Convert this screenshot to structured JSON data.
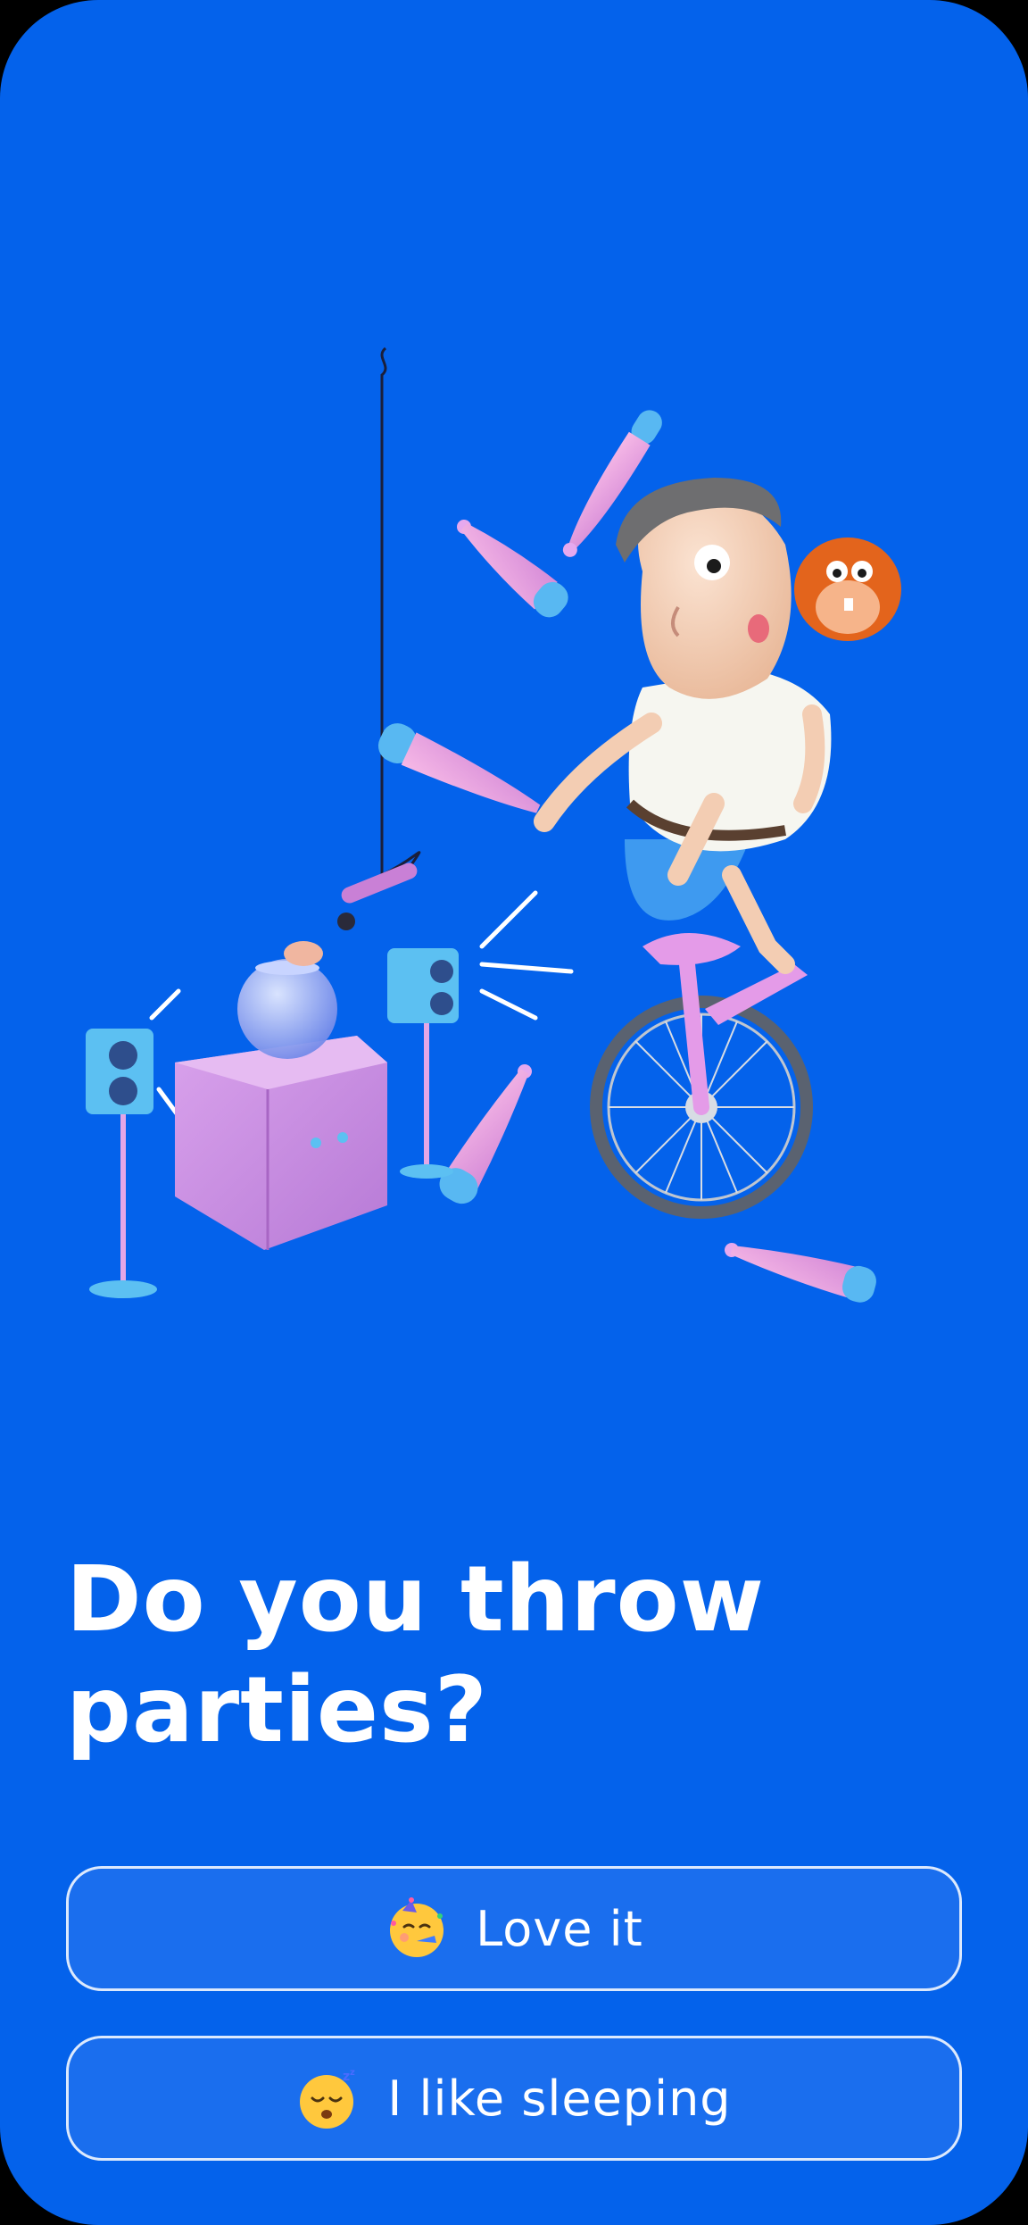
{
  "question": "Do you throw parties?",
  "options": [
    {
      "emoji": "partying-face-icon",
      "label": "Love it"
    },
    {
      "emoji": "sleeping-face-icon",
      "label": "I like sleeping"
    }
  ],
  "colors": {
    "background": "#0462EB",
    "button_fill": "#1A6EEE",
    "button_border": "#FFFFFF",
    "text": "#FFFFFF"
  }
}
